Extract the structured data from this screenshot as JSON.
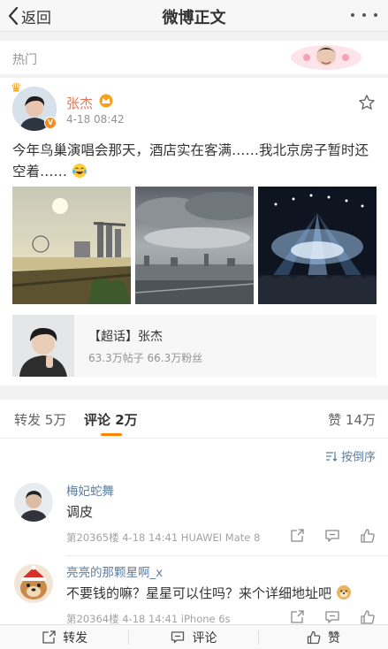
{
  "nav": {
    "back_label": "返回",
    "title": "微博正文"
  },
  "hot": {
    "label": "热门"
  },
  "post": {
    "author": "张杰",
    "time": "4-18 08:42",
    "text": "今年鸟巢演唱会那天，酒店实在客满……我北京房子暂时还空着……",
    "emoji_icon": "laughing-tears-emoji",
    "topic": {
      "title": "【超话】张杰",
      "stats": "63.3万帖子 66.3万粉丝"
    }
  },
  "tabs": {
    "forward": "转发 5万",
    "comment": "评论 2万",
    "like": "赞 14万"
  },
  "comments": {
    "sort_label": "按倒序",
    "items": [
      {
        "name": "梅妃蛇舞",
        "text": "调皮",
        "meta": "第20365楼 4-18 14:41 HUAWEI Mate 8"
      },
      {
        "name": "亮亮的那颗星啊_x",
        "text": "不要钱的嘛？星星可以住吗？来个详细地址吧",
        "meta": "第20364楼 4-18 14:41 iPhone 6s"
      }
    ]
  },
  "bottom": {
    "forward": "转发",
    "comment": "评论",
    "like": "赞"
  },
  "colors": {
    "accent": "#ff8200",
    "author": "#eb7350",
    "link": "#5b7fa6"
  }
}
